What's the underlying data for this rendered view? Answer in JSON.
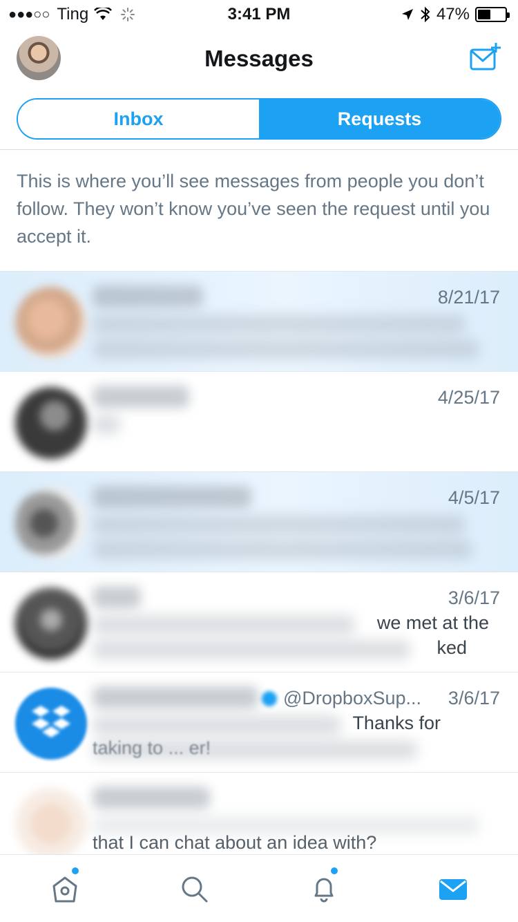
{
  "status_bar": {
    "signal": "●●●○○",
    "carrier": "Ting",
    "time": "3:41 PM",
    "battery": "47%",
    "battery_level": 0.47
  },
  "header": {
    "title": "Messages"
  },
  "segments": {
    "inbox": "Inbox",
    "requests": "Requests",
    "selected": "requests"
  },
  "info_text": "This is where you’ll see messages from people you don’t follow. They won’t know you’ve seen the request until you accept it.",
  "requests": [
    {
      "date": "8/21/17",
      "unread": true,
      "handle": "",
      "snippet1": "",
      "snippet2": ""
    },
    {
      "date": "4/25/17",
      "unread": false,
      "handle": "",
      "snippet1": "",
      "snippet2": ""
    },
    {
      "date": "4/5/17",
      "unread": true,
      "handle": "",
      "snippet1": "",
      "snippet2": ""
    },
    {
      "date": "3/6/17",
      "unread": false,
      "handle": "",
      "snippet1": "we met at the",
      "snippet2": "ked"
    },
    {
      "date": "3/6/17",
      "unread": false,
      "handle": "@DropboxSup...",
      "snippet1": "Thanks for",
      "snippet2": "taking to ... er!"
    },
    {
      "date": "",
      "unread": false,
      "handle": "",
      "snippet1": "",
      "snippet2": "that I can chat about an idea with?"
    }
  ],
  "tabs": {
    "home_icon": "home-icon",
    "search_icon": "search-icon",
    "notifications_icon": "bell-icon",
    "messages_icon": "envelope-icon",
    "active": "messages"
  },
  "colors": {
    "accent": "#1da1f2",
    "secondary_text": "#657786",
    "unread_row": "#e4f1fc"
  }
}
